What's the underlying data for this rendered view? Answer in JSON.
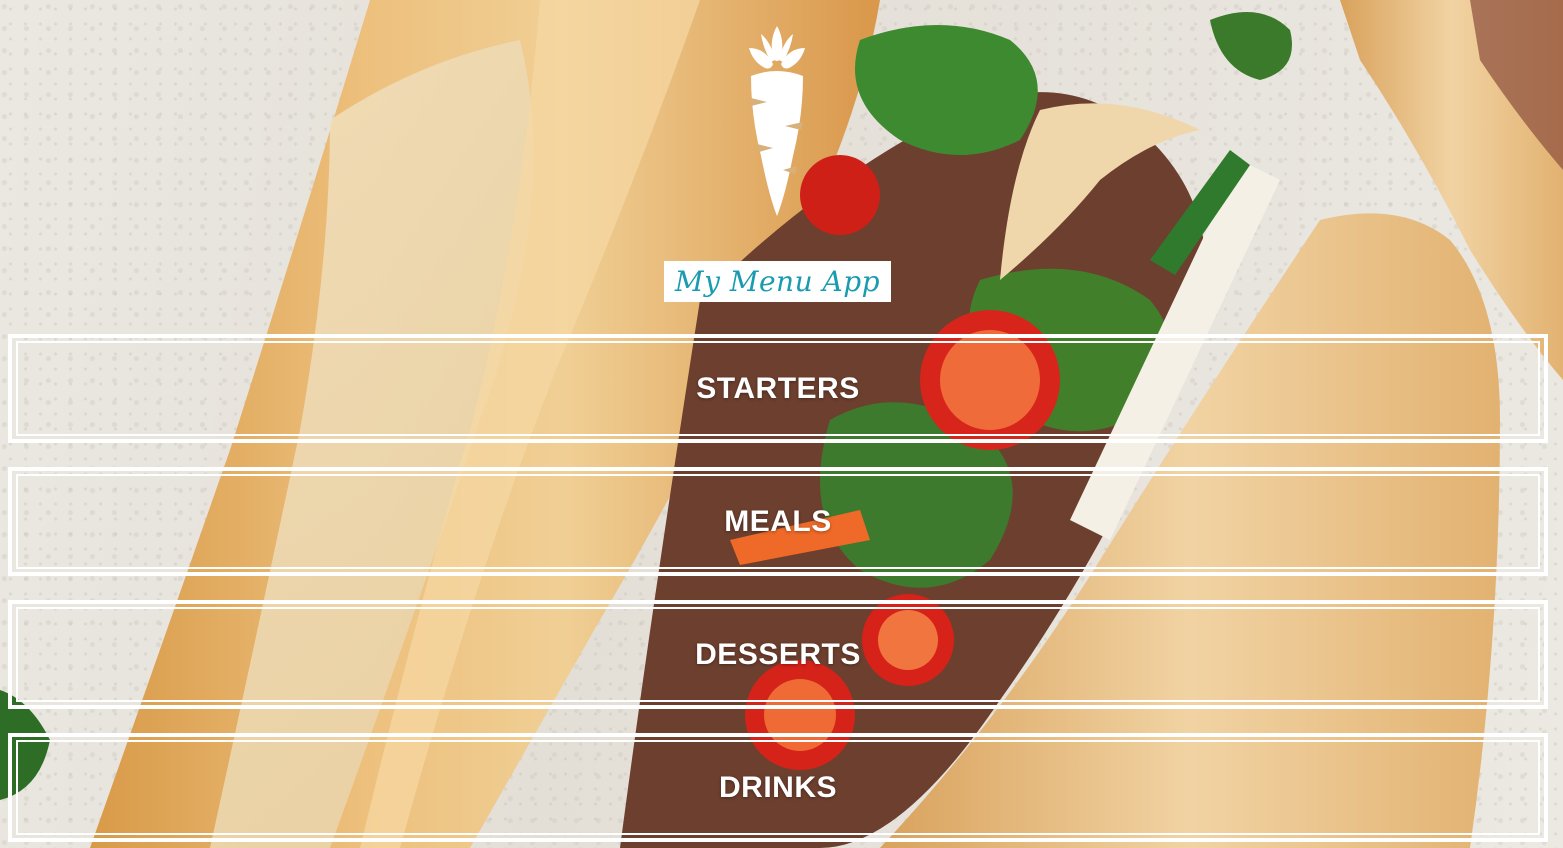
{
  "app": {
    "brand_name": "My Menu App",
    "logo_icon": "carrot-icon"
  },
  "menu": {
    "items": [
      {
        "label": "STARTERS"
      },
      {
        "label": "MEALS"
      },
      {
        "label": "DESSERTS"
      },
      {
        "label": "DRINKS"
      }
    ]
  },
  "colors": {
    "brand_text": "#1a9bb0",
    "button_border": "#ffffff",
    "button_text": "#ffffff"
  },
  "background": {
    "image_subject": "banh-mi-sandwiches-photo"
  }
}
